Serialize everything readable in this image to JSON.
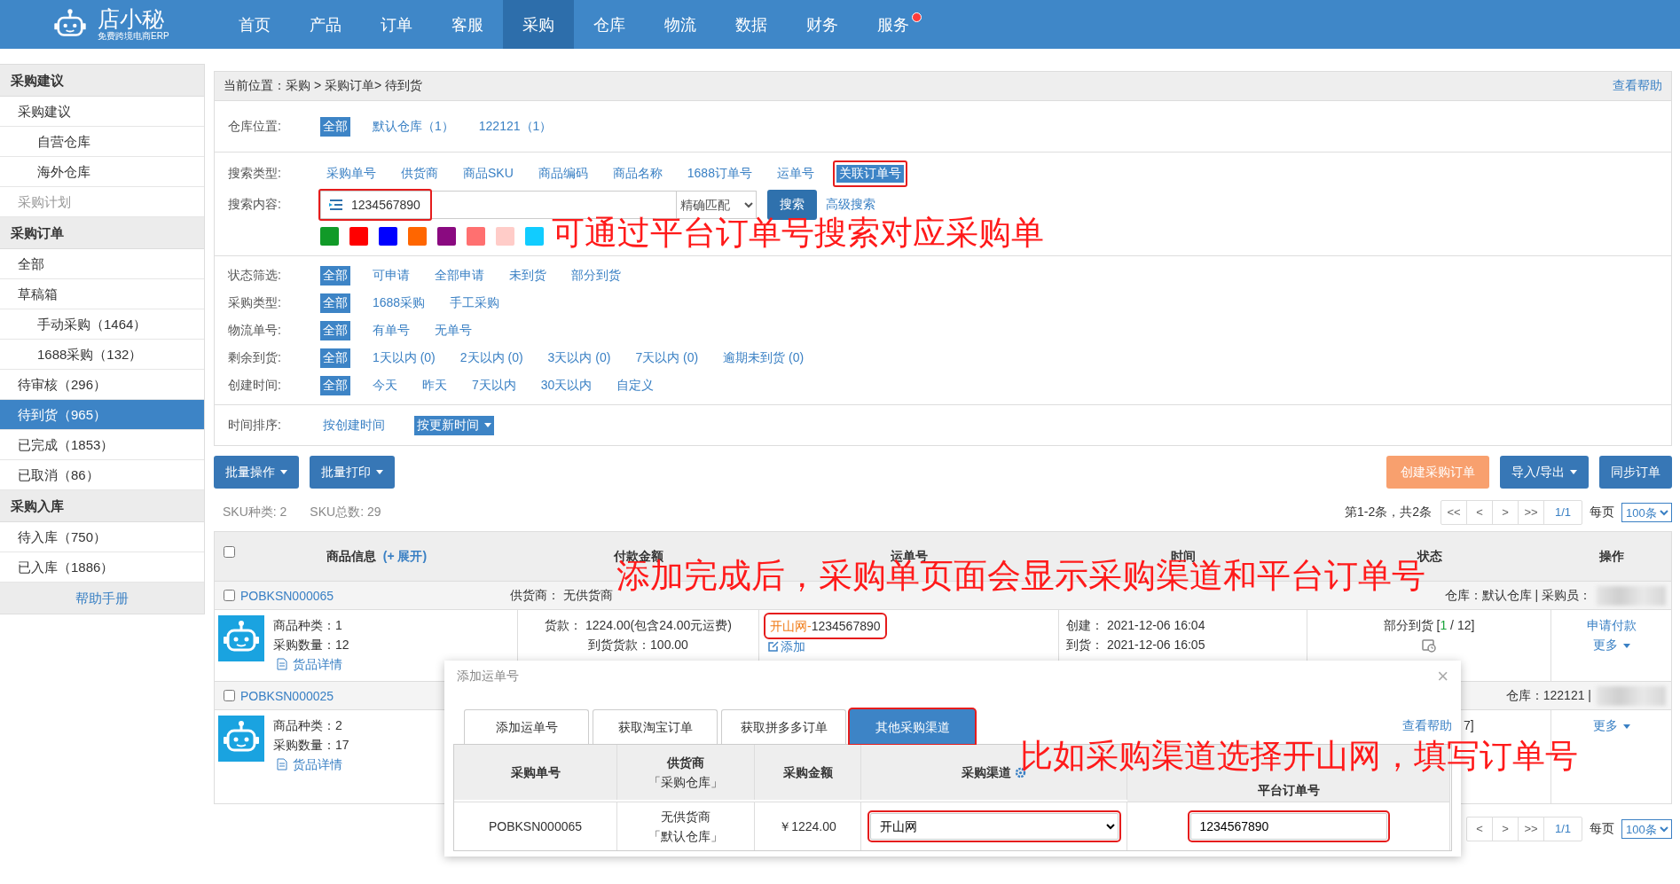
{
  "nav": {
    "logo": "店小秘",
    "logo_tagline": "免费跨境电商ERP",
    "items": [
      {
        "label": "首页",
        "selected": false,
        "notification": false
      },
      {
        "label": "产品",
        "selected": false,
        "notification": false
      },
      {
        "label": "订单",
        "selected": false,
        "notification": false
      },
      {
        "label": "客服",
        "selected": false,
        "notification": false
      },
      {
        "label": "采购",
        "selected": true,
        "notification": false
      },
      {
        "label": "仓库",
        "selected": false,
        "notification": false
      },
      {
        "label": "物流",
        "selected": false,
        "notification": false
      },
      {
        "label": "数据",
        "selected": false,
        "notification": false
      },
      {
        "label": "财务",
        "selected": false,
        "notification": false
      },
      {
        "label": "服务",
        "selected": false,
        "notification": true
      }
    ]
  },
  "sidebar": {
    "sections": [
      {
        "title": "采购建议",
        "items": [
          {
            "label": "采购建议",
            "selected": false,
            "disabled": false,
            "children": [
              {
                "label": "自营仓库",
                "selected": false,
                "disabled": false
              },
              {
                "label": "海外仓库",
                "selected": false,
                "disabled": false
              }
            ]
          },
          {
            "label": "采购计划",
            "selected": false,
            "disabled": true
          }
        ]
      },
      {
        "title": "采购订单",
        "items": [
          {
            "label": "全部",
            "selected": false,
            "disabled": false
          },
          {
            "label": "草稿箱",
            "selected": false,
            "disabled": false,
            "children": [
              {
                "label": "手动采购（1464）",
                "selected": false,
                "disabled": false
              },
              {
                "label": "1688采购（132）",
                "selected": false,
                "disabled": false
              }
            ]
          },
          {
            "label": "待审核（296）",
            "selected": false,
            "disabled": false
          },
          {
            "label": "待到货（965）",
            "selected": true,
            "disabled": false
          },
          {
            "label": "已完成（1853）",
            "selected": false,
            "disabled": false
          },
          {
            "label": "已取消（86）",
            "selected": false,
            "disabled": false
          }
        ]
      },
      {
        "title": "采购入库",
        "items": [
          {
            "label": "待入库（750）",
            "selected": false,
            "disabled": false
          },
          {
            "label": "已入库（1886）",
            "selected": false,
            "disabled": false
          }
        ]
      }
    ],
    "help": "帮助手册"
  },
  "breadcrumb": {
    "path": "当前位置：采购 > 采购订单> 待到货",
    "help": "查看帮助"
  },
  "warehouse_filter": {
    "label": "仓库位置:",
    "options": [
      {
        "label": "全部",
        "selected": true
      },
      {
        "label": "默认仓库（1）",
        "selected": false
      },
      {
        "label": "122121（1）",
        "selected": false
      }
    ]
  },
  "search": {
    "type_label": "搜索类型:",
    "types": [
      {
        "label": "采购单号",
        "selected": false,
        "highlighted": false
      },
      {
        "label": "供货商",
        "selected": false,
        "highlighted": false
      },
      {
        "label": "商品SKU",
        "selected": false,
        "highlighted": false
      },
      {
        "label": "商品编码",
        "selected": false,
        "highlighted": false
      },
      {
        "label": "商品名称",
        "selected": false,
        "highlighted": false
      },
      {
        "label": "1688订单号",
        "selected": false,
        "highlighted": false
      },
      {
        "label": "运单号",
        "selected": false,
        "highlighted": false
      },
      {
        "label": "关联订单号",
        "selected": true,
        "highlighted": true
      }
    ],
    "content_label": "搜索内容:",
    "value": "1234567890",
    "value_highlighted": true,
    "match": "精确匹配",
    "button": "搜索",
    "advanced": "高级搜索",
    "color_tags": [
      {
        "color": "#119a28"
      },
      {
        "color": "#ff0000"
      },
      {
        "color": "#0000ff"
      },
      {
        "color": "#ff6600"
      },
      {
        "color": "#8a0a80"
      },
      {
        "color": "#ff7070"
      },
      {
        "color": "#ffccc8"
      },
      {
        "color": "#11ccff"
      }
    ]
  },
  "filters": [
    {
      "label": "状态筛选:",
      "options": [
        {
          "label": "全部",
          "selected": true
        },
        {
          "label": "可申请",
          "selected": false
        },
        {
          "label": "全部申请",
          "selected": false
        },
        {
          "label": "未到货",
          "selected": false
        },
        {
          "label": "部分到货",
          "selected": false
        }
      ]
    },
    {
      "label": "采购类型:",
      "options": [
        {
          "label": "全部",
          "selected": true
        },
        {
          "label": "1688采购",
          "selected": false
        },
        {
          "label": "手工采购",
          "selected": false
        }
      ]
    },
    {
      "label": "物流单号:",
      "options": [
        {
          "label": "全部",
          "selected": true
        },
        {
          "label": "有单号",
          "selected": false
        },
        {
          "label": "无单号",
          "selected": false
        }
      ]
    },
    {
      "label": "剩余到货:",
      "options": [
        {
          "label": "全部",
          "selected": true
        },
        {
          "label": "1天以内 (0)",
          "selected": false
        },
        {
          "label": "2天以内 (0)",
          "selected": false
        },
        {
          "label": "3天以内 (0)",
          "selected": false
        },
        {
          "label": "7天以内 (0)",
          "selected": false
        },
        {
          "label": "逾期未到货 (0)",
          "selected": false
        }
      ]
    },
    {
      "label": "创建时间:",
      "options": [
        {
          "label": "全部",
          "selected": true
        },
        {
          "label": "今天",
          "selected": false
        },
        {
          "label": "昨天",
          "selected": false
        },
        {
          "label": "7天以内",
          "selected": false
        },
        {
          "label": "30天以内",
          "selected": false
        },
        {
          "label": "自定义",
          "selected": false
        }
      ]
    }
  ],
  "sort": {
    "label": "时间排序:",
    "options": [
      {
        "label": "按创建时间",
        "selected": false
      },
      {
        "label": "按更新时间",
        "selected": true
      }
    ]
  },
  "toolbar": {
    "left": [
      {
        "label": "批量操作",
        "kind": "primary",
        "dropdown": true
      },
      {
        "label": "批量打印",
        "kind": "primary",
        "dropdown": true
      }
    ],
    "right": [
      {
        "label": "创建采购订单",
        "kind": "create",
        "dropdown": false
      },
      {
        "label": "导入/导出",
        "kind": "primary",
        "dropdown": true
      },
      {
        "label": "同步订单",
        "kind": "primary",
        "dropdown": false
      }
    ]
  },
  "summary": [
    "SKU种类: 2",
    "SKU总数: 29"
  ],
  "pagination": {
    "info": "第1-2条，共2条",
    "buttons": [
      "<<",
      "<",
      ">",
      ">>"
    ],
    "page": "1/1",
    "per_page_label": "每页",
    "per_page": "100条"
  },
  "table": {
    "select_all": false,
    "columns": [
      {
        "label": "商品信息",
        "link": "(+ 展开)"
      },
      {
        "label": "付款金额"
      },
      {
        "label": "运单号"
      },
      {
        "label": "时间"
      },
      {
        "label": "状态"
      },
      {
        "label": "操作"
      }
    ],
    "rows": [
      {
        "checked": false,
        "order_no": "POBKSN000065",
        "supplier": "供货商：  无供货商",
        "warehouse": "仓库：默认仓库 | 采购员：",
        "product_kinds": "商品种类：1",
        "quantity": "采购数量：12",
        "detail": "货品详情",
        "payment": "货款：  1224.00(包含24.00元运费)",
        "arrival_payment": "到货货款：100.00",
        "tracking_channel": "开山网-",
        "tracking_number": "1234567890",
        "tracking_highlighted": true,
        "tracking_add": "添加",
        "times": [
          "创建：  2021-12-06 16:04",
          "到货：  2021-12-06 16:05"
        ],
        "status": {
          "label": "部分到货 [",
          "received": "1",
          "rest": " / 12]"
        },
        "actions": [
          {
            "label": "申请付款",
            "dropdown": false
          },
          {
            "label": "更多",
            "dropdown": true
          }
        ]
      },
      {
        "checked": false,
        "order_no": "POBKSN000025",
        "warehouse": "仓库：122121 |",
        "product_kinds": "商品种类：2",
        "quantity": "采购数量：17",
        "detail": "货品详情",
        "status": {
          "rest": "7]"
        },
        "actions": [
          {
            "label": "更多",
            "dropdown": true
          }
        ]
      }
    ]
  },
  "bottom_pagination": {
    "buttons": [
      "<",
      ">",
      ">>"
    ],
    "page": "1/1",
    "per_page_label": "每页",
    "per_page": "100条"
  },
  "dialog": {
    "title": "添加运单号",
    "close": "×",
    "help": "查看帮助",
    "tabs": [
      {
        "label": "添加运单号",
        "selected": false,
        "highlighted": false
      },
      {
        "label": "获取淘宝订单",
        "selected": false,
        "highlighted": false
      },
      {
        "label": "获取拼多多订单",
        "selected": false,
        "highlighted": false
      },
      {
        "label": "其他采购渠道",
        "selected": true,
        "highlighted": true
      }
    ],
    "columns": [
      {
        "label": "采购单号"
      },
      {
        "label": "供货商",
        "sublabel": "「采购仓库」"
      },
      {
        "label": "采购金额"
      },
      {
        "label": "采购渠道",
        "settings": true
      },
      {
        "label": "平台订单号"
      }
    ],
    "row": {
      "order_no": "POBKSN000065",
      "supplier": "无供货商",
      "warehouse": "「默认仓库」",
      "amount": "￥1224.00",
      "channel": "开山网",
      "channel_highlighted": true,
      "order_number": "1234567890",
      "order_number_highlighted": true
    }
  },
  "annotations": [
    {
      "text": "可通过平台订单号搜索对应采购单"
    },
    {
      "text": "添加完成后，采购单页面会显示采购渠道和平台订单号"
    },
    {
      "text": "比如采购渠道选择开山网，填写订单号"
    }
  ]
}
